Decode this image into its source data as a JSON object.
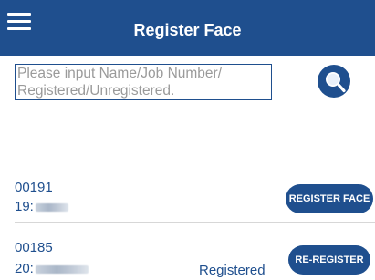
{
  "header": {
    "title": "Register Face",
    "background": "#1f4f8e"
  },
  "search": {
    "placeholder": "Please input Name/Job Number/\nRegistered/Unregistered.",
    "value": ""
  },
  "records": [
    {
      "job_number": "00191",
      "name_prefix": "19:",
      "status": "",
      "action_label": "REGISTER FACE"
    },
    {
      "job_number": "00185",
      "name_prefix": "20:",
      "status": "Registered",
      "action_label": "RE-REGISTER"
    }
  ],
  "icons": {
    "menu": "hamburger-menu-icon",
    "search": "magnifier-icon"
  }
}
